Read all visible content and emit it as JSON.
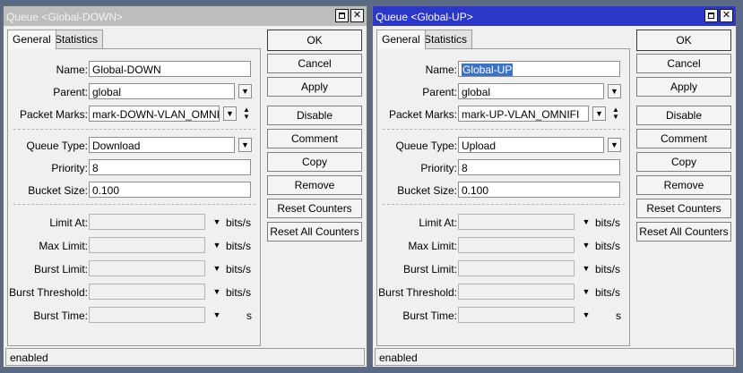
{
  "windows": [
    {
      "title": "Queue <Global-DOWN>",
      "tabs": {
        "general": "General",
        "statistics": "Statistics"
      },
      "fields": {
        "name": {
          "label": "Name:",
          "value": "Global-DOWN"
        },
        "parent": {
          "label": "Parent:",
          "value": "global"
        },
        "packet_marks": {
          "label": "Packet Marks:",
          "value": "mark-DOWN-VLAN_OMNIFI"
        },
        "queue_type": {
          "label": "Queue Type:",
          "value": "Download"
        },
        "priority": {
          "label": "Priority:",
          "value": "8"
        },
        "bucket_size": {
          "label": "Bucket Size:",
          "value": "0.100"
        },
        "limit_at": {
          "label": "Limit At:",
          "value": "",
          "unit": "bits/s"
        },
        "max_limit": {
          "label": "Max Limit:",
          "value": "",
          "unit": "bits/s"
        },
        "burst_limit": {
          "label": "Burst Limit:",
          "value": "",
          "unit": "bits/s"
        },
        "burst_threshold": {
          "label": "Burst Threshold:",
          "value": "",
          "unit": "bits/s"
        },
        "burst_time": {
          "label": "Burst Time:",
          "value": "",
          "unit": "s"
        }
      },
      "buttons": {
        "ok": "OK",
        "cancel": "Cancel",
        "apply": "Apply",
        "disable": "Disable",
        "comment": "Comment",
        "copy": "Copy",
        "remove": "Remove",
        "reset_counters": "Reset Counters",
        "reset_all_counters": "Reset All Counters"
      },
      "status": "enabled",
      "active": false
    },
    {
      "title": "Queue <Global-UP>",
      "tabs": {
        "general": "General",
        "statistics": "Statistics"
      },
      "fields": {
        "name": {
          "label": "Name:",
          "value": "Global-UP"
        },
        "parent": {
          "label": "Parent:",
          "value": "global"
        },
        "packet_marks": {
          "label": "Packet Marks:",
          "value": "mark-UP-VLAN_OMNIFI"
        },
        "queue_type": {
          "label": "Queue Type:",
          "value": "Upload"
        },
        "priority": {
          "label": "Priority:",
          "value": "8"
        },
        "bucket_size": {
          "label": "Bucket Size:",
          "value": "0.100"
        },
        "limit_at": {
          "label": "Limit At:",
          "value": "",
          "unit": "bits/s"
        },
        "max_limit": {
          "label": "Max Limit:",
          "value": "",
          "unit": "bits/s"
        },
        "burst_limit": {
          "label": "Burst Limit:",
          "value": "",
          "unit": "bits/s"
        },
        "burst_threshold": {
          "label": "Burst Threshold:",
          "value": "",
          "unit": "bits/s"
        },
        "burst_time": {
          "label": "Burst Time:",
          "value": "",
          "unit": "s"
        }
      },
      "buttons": {
        "ok": "OK",
        "cancel": "Cancel",
        "apply": "Apply",
        "disable": "Disable",
        "comment": "Comment",
        "copy": "Copy",
        "remove": "Remove",
        "reset_counters": "Reset Counters",
        "reset_all_counters": "Reset All Counters"
      },
      "status": "enabled",
      "active": true
    }
  ],
  "colors": {
    "active_title": "#2a37c8",
    "inactive_title": "#bdbdbd",
    "selection": "#3b72c9"
  },
  "icons": {
    "dropdown": "dropdown-arrow-icon",
    "updown": "updown-icon",
    "maximize": "maximize-icon",
    "close": "close-icon"
  }
}
